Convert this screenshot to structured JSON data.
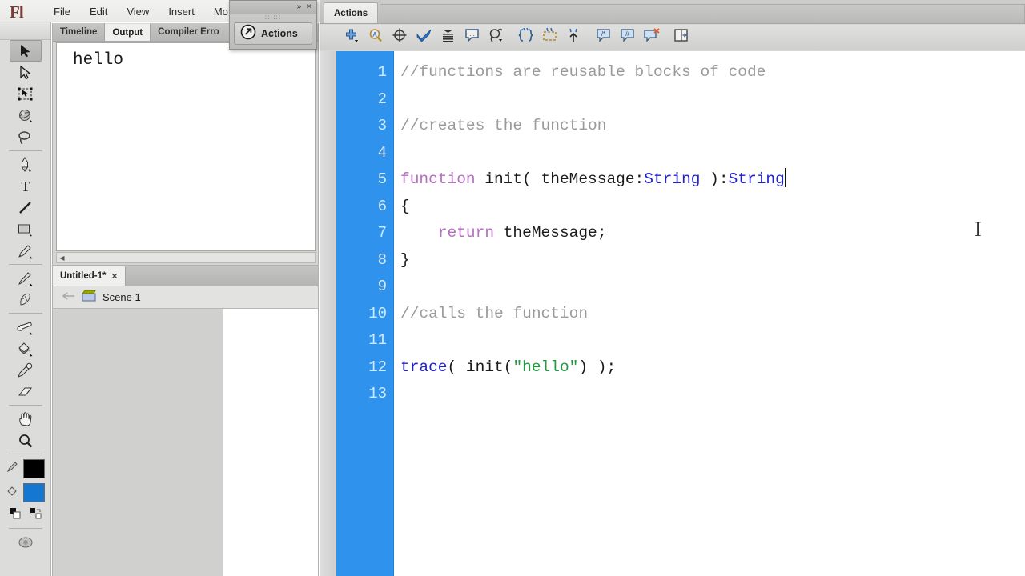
{
  "app": {
    "logo": "Fl",
    "menus": [
      "File",
      "Edit",
      "View",
      "Insert",
      "Mo"
    ]
  },
  "tools": {
    "items": [
      {
        "name": "selection-tool",
        "icon": "arrow-solid",
        "selected": true
      },
      {
        "name": "subselection-tool",
        "icon": "arrow-outline",
        "selected": false
      },
      {
        "name": "free-transform-tool",
        "icon": "transform",
        "selected": false
      },
      {
        "name": "3d-rotation-tool",
        "icon": "sphere",
        "selected": false
      },
      {
        "name": "lasso-tool",
        "icon": "lasso",
        "selected": false
      },
      {
        "name": "pen-tool",
        "icon": "pen",
        "selected": false
      },
      {
        "name": "text-tool",
        "icon": "text-T",
        "selected": false
      },
      {
        "name": "line-tool",
        "icon": "line",
        "selected": false
      },
      {
        "name": "rectangle-tool",
        "icon": "rectangle",
        "selected": false
      },
      {
        "name": "pencil-tool",
        "icon": "pencil",
        "selected": false
      },
      {
        "name": "brush-tool",
        "icon": "brush",
        "selected": false
      },
      {
        "name": "deco-tool",
        "icon": "deco",
        "selected": false
      },
      {
        "name": "bone-tool",
        "icon": "bone",
        "selected": false
      },
      {
        "name": "paint-bucket-tool",
        "icon": "paint-bucket",
        "selected": false
      },
      {
        "name": "eyedropper-tool",
        "icon": "eyedropper",
        "selected": false
      },
      {
        "name": "eraser-tool",
        "icon": "eraser",
        "selected": false
      },
      {
        "name": "hand-tool",
        "icon": "hand",
        "selected": false
      },
      {
        "name": "zoom-tool",
        "icon": "magnifier",
        "selected": false
      }
    ],
    "stroke_color": "#000000",
    "fill_color": "#1478d2"
  },
  "output_panel": {
    "tabs": [
      {
        "label": "Timeline",
        "active": false
      },
      {
        "label": "Output",
        "active": true
      },
      {
        "label": "Compiler Erro",
        "active": false
      }
    ],
    "content": "hello"
  },
  "document_tabs": [
    {
      "label": "Untitled-1*",
      "close": "×",
      "active": true
    }
  ],
  "scene_bar": {
    "back_arrow": "←",
    "scene_label": "Scene 1"
  },
  "float_panel": {
    "expand_icon": "»",
    "close_icon": "×",
    "grip": "∷∷∷",
    "button_label": "Actions",
    "button_icon": "arrow-circle"
  },
  "actions_panel": {
    "tab_label": "Actions",
    "toolbar_buttons": [
      {
        "name": "add-script-icon",
        "title": "Add a new item to the script"
      },
      {
        "name": "find-icon",
        "title": "Find"
      },
      {
        "name": "insert-target-path-icon",
        "title": "Insert target path"
      },
      {
        "name": "check-syntax-icon",
        "title": "Check syntax"
      },
      {
        "name": "auto-format-icon",
        "title": "Auto format"
      },
      {
        "name": "show-code-hint-icon",
        "title": "Show code hint"
      },
      {
        "name": "debug-options-icon",
        "title": "Debug options"
      },
      {
        "name": "collapse-between-braces-icon",
        "title": "Collapse between braces"
      },
      {
        "name": "collapse-selection-icon",
        "title": "Collapse selection"
      },
      {
        "name": "expand-all-icon",
        "title": "Expand all"
      },
      {
        "name": "apply-block-comment-icon",
        "title": "Apply block comment"
      },
      {
        "name": "apply-line-comment-icon",
        "title": "Apply line comment"
      },
      {
        "name": "remove-comment-icon",
        "title": "Remove comment"
      },
      {
        "name": "show-hide-toolbox-icon",
        "title": "Show/Hide toolbox"
      }
    ],
    "line_numbers": [
      "1",
      "2",
      "3",
      "4",
      "5",
      "6",
      "7",
      "8",
      "9",
      "10",
      "11",
      "12",
      "13"
    ],
    "code_lines": [
      [
        {
          "t": "comment",
          "v": "//functions are reusable blocks of code"
        }
      ],
      [],
      [
        {
          "t": "comment",
          "v": "//creates the function"
        }
      ],
      [],
      [
        {
          "t": "keyword",
          "v": "function"
        },
        {
          "t": "plain",
          "v": " init( theMessage:"
        },
        {
          "t": "type",
          "v": "String"
        },
        {
          "t": "plain",
          "v": " ):"
        },
        {
          "t": "type",
          "v": "String"
        },
        {
          "t": "caret",
          "v": ""
        }
      ],
      [
        {
          "t": "plain",
          "v": "{"
        }
      ],
      [
        {
          "t": "plain",
          "v": "    "
        },
        {
          "t": "keyword",
          "v": "return"
        },
        {
          "t": "plain",
          "v": " theMessage;"
        }
      ],
      [
        {
          "t": "plain",
          "v": "}"
        }
      ],
      [],
      [
        {
          "t": "comment",
          "v": "//calls the function"
        }
      ],
      [],
      [
        {
          "t": "fn",
          "v": "trace"
        },
        {
          "t": "plain",
          "v": "( init("
        },
        {
          "t": "string",
          "v": "\"hello\""
        },
        {
          "t": "plain",
          "v": ") );"
        }
      ],
      []
    ],
    "cursor_glyph": "I"
  },
  "colors": {
    "gutter_blue": "#2f93ee",
    "gutter_text": "#cfeaff",
    "keyword": "#b56fc0",
    "type": "#2222cc",
    "string": "#1f9e3f",
    "comment": "#9a9a9a",
    "chrome": "#d6d6d4"
  }
}
